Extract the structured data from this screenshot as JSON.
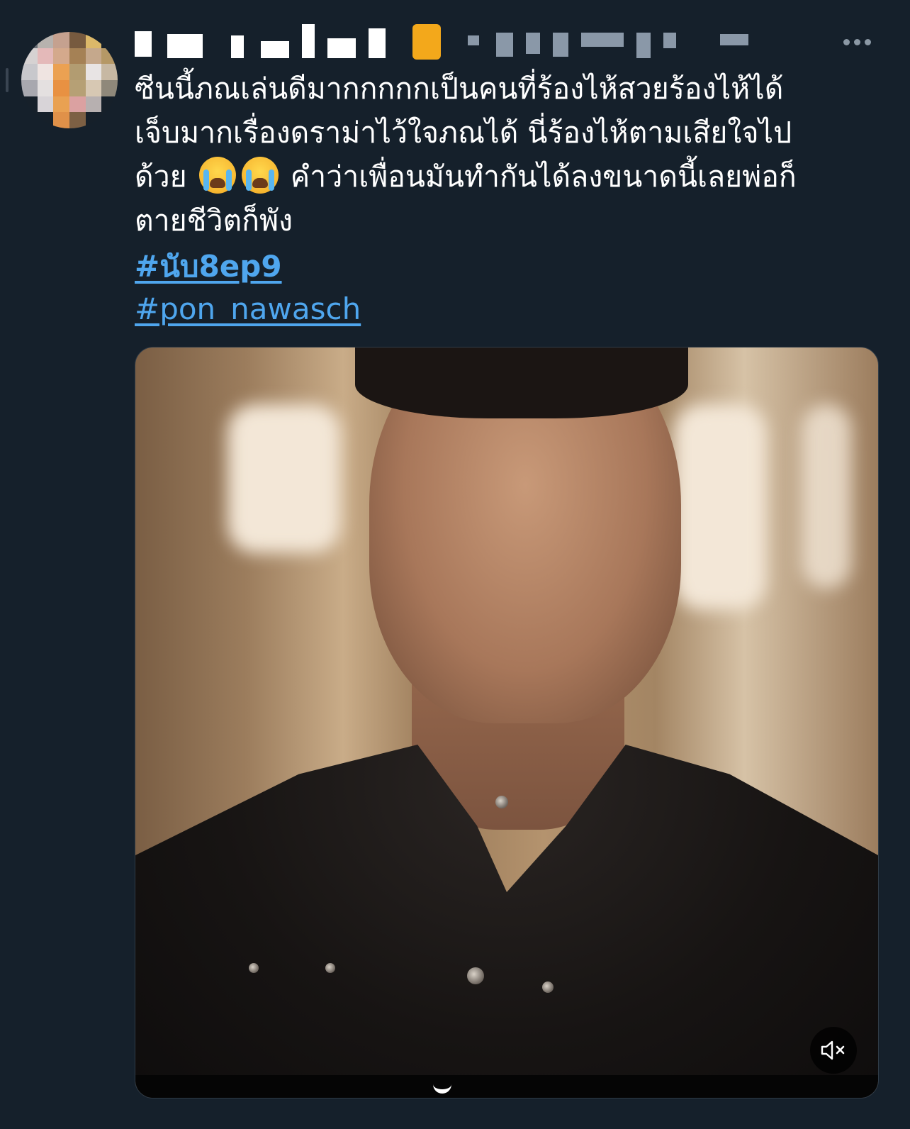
{
  "tweet": {
    "text_lines": [
      "ซีนนี้ภณเล่นดีมากกกกกเป็นคนที่ร้องไห้สวยร้องไห้ได้",
      "เจ็บมากเรื่องดราม่าไว้ใจภณได้ นี่ร้องไห้ตามเสียใจไป",
      "ด้วย",
      " คำว่าเพื่อนมันทำกันได้ลงขนาดนี้เลยพ่อก็",
      "ตายชีวิตก็พัง"
    ],
    "emojis": [
      "loudly-crying-face",
      "loudly-crying-face"
    ],
    "hashtags": [
      "#นับ8ep9",
      "#pon_nawasch"
    ]
  },
  "colors": {
    "background": "#15202b",
    "text": "#ffffff",
    "link": "#4fa6ee",
    "icon": "#8b98a5"
  },
  "icons": {
    "more": "more-horizontal-icon",
    "mute": "volume-muted-icon"
  }
}
